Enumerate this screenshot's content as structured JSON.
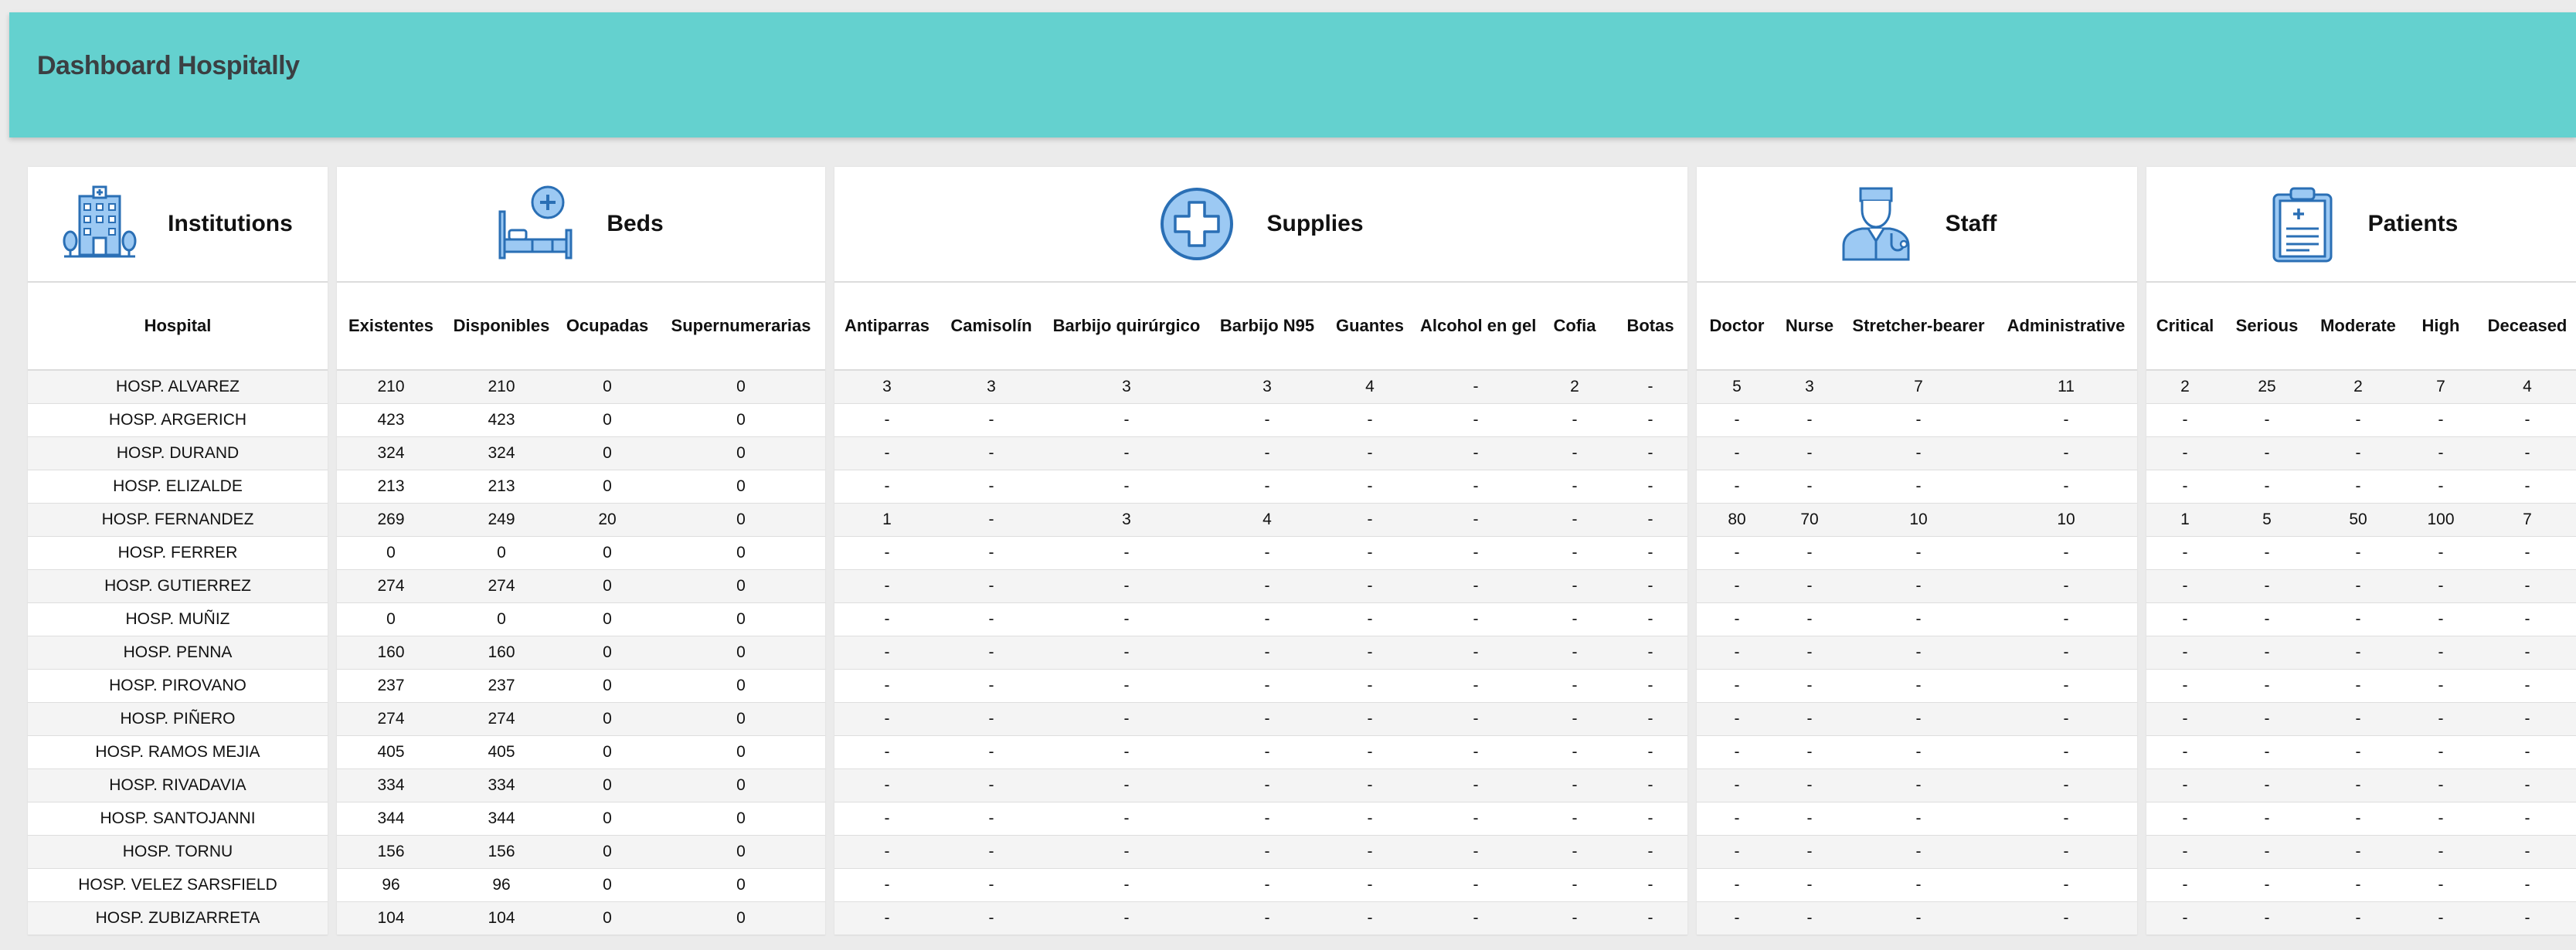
{
  "app": {
    "title": "Dashboard Hospitally"
  },
  "colors": {
    "header_bg": "#64d1cf",
    "icon_fill": "#9cc9f3",
    "icon_stroke": "#2a6fb5"
  },
  "panels": {
    "institutions": {
      "title": "Institutions",
      "icon": "hospital-building-icon",
      "columns": [
        "Hospital"
      ],
      "rows": [
        [
          "HOSP. ALVAREZ"
        ],
        [
          "HOSP. ARGERICH"
        ],
        [
          "HOSP. DURAND"
        ],
        [
          "HOSP. ELIZALDE"
        ],
        [
          "HOSP. FERNANDEZ"
        ],
        [
          "HOSP. FERRER"
        ],
        [
          "HOSP. GUTIERREZ"
        ],
        [
          "HOSP. MUÑIZ"
        ],
        [
          "HOSP. PENNA"
        ],
        [
          "HOSP. PIROVANO"
        ],
        [
          "HOSP. PIÑERO"
        ],
        [
          "HOSP. RAMOS MEJIA"
        ],
        [
          "HOSP. RIVADAVIA"
        ],
        [
          "HOSP. SANTOJANNI"
        ],
        [
          "HOSP. TORNU"
        ],
        [
          "HOSP. VELEZ SARSFIELD"
        ],
        [
          "HOSP. ZUBIZARRETA"
        ]
      ]
    },
    "beds": {
      "title": "Beds",
      "icon": "hospital-bed-icon",
      "columns": [
        "Existentes",
        "Disponibles",
        "Ocupadas",
        "Supernumerarias"
      ],
      "rows": [
        [
          "210",
          "210",
          "0",
          "0"
        ],
        [
          "423",
          "423",
          "0",
          "0"
        ],
        [
          "324",
          "324",
          "0",
          "0"
        ],
        [
          "213",
          "213",
          "0",
          "0"
        ],
        [
          "269",
          "249",
          "20",
          "0"
        ],
        [
          "0",
          "0",
          "0",
          "0"
        ],
        [
          "274",
          "274",
          "0",
          "0"
        ],
        [
          "0",
          "0",
          "0",
          "0"
        ],
        [
          "160",
          "160",
          "0",
          "0"
        ],
        [
          "237",
          "237",
          "0",
          "0"
        ],
        [
          "274",
          "274",
          "0",
          "0"
        ],
        [
          "405",
          "405",
          "0",
          "0"
        ],
        [
          "334",
          "334",
          "0",
          "0"
        ],
        [
          "344",
          "344",
          "0",
          "0"
        ],
        [
          "156",
          "156",
          "0",
          "0"
        ],
        [
          "96",
          "96",
          "0",
          "0"
        ],
        [
          "104",
          "104",
          "0",
          "0"
        ]
      ]
    },
    "supplies": {
      "title": "Supplies",
      "icon": "medical-cross-icon",
      "columns": [
        "Antiparras",
        "Camisolín",
        "Barbijo quirúrgico",
        "Barbijo N95",
        "Guantes",
        "Alcohol en gel",
        "Cofia",
        "Botas"
      ],
      "rows": [
        [
          "3",
          "3",
          "3",
          "3",
          "4",
          "-",
          "2",
          "-"
        ],
        [
          "-",
          "-",
          "-",
          "-",
          "-",
          "-",
          "-",
          "-"
        ],
        [
          "-",
          "-",
          "-",
          "-",
          "-",
          "-",
          "-",
          "-"
        ],
        [
          "-",
          "-",
          "-",
          "-",
          "-",
          "-",
          "-",
          "-"
        ],
        [
          "1",
          "-",
          "3",
          "4",
          "-",
          "-",
          "-",
          "-"
        ],
        [
          "-",
          "-",
          "-",
          "-",
          "-",
          "-",
          "-",
          "-"
        ],
        [
          "-",
          "-",
          "-",
          "-",
          "-",
          "-",
          "-",
          "-"
        ],
        [
          "-",
          "-",
          "-",
          "-",
          "-",
          "-",
          "-",
          "-"
        ],
        [
          "-",
          "-",
          "-",
          "-",
          "-",
          "-",
          "-",
          "-"
        ],
        [
          "-",
          "-",
          "-",
          "-",
          "-",
          "-",
          "-",
          "-"
        ],
        [
          "-",
          "-",
          "-",
          "-",
          "-",
          "-",
          "-",
          "-"
        ],
        [
          "-",
          "-",
          "-",
          "-",
          "-",
          "-",
          "-",
          "-"
        ],
        [
          "-",
          "-",
          "-",
          "-",
          "-",
          "-",
          "-",
          "-"
        ],
        [
          "-",
          "-",
          "-",
          "-",
          "-",
          "-",
          "-",
          "-"
        ],
        [
          "-",
          "-",
          "-",
          "-",
          "-",
          "-",
          "-",
          "-"
        ],
        [
          "-",
          "-",
          "-",
          "-",
          "-",
          "-",
          "-",
          "-"
        ],
        [
          "-",
          "-",
          "-",
          "-",
          "-",
          "-",
          "-",
          "-"
        ]
      ]
    },
    "staff": {
      "title": "Staff",
      "icon": "doctor-icon",
      "columns": [
        "Doctor",
        "Nurse",
        "Stretcher-bearer",
        "Administrative"
      ],
      "rows": [
        [
          "5",
          "3",
          "7",
          "11"
        ],
        [
          "-",
          "-",
          "-",
          "-"
        ],
        [
          "-",
          "-",
          "-",
          "-"
        ],
        [
          "-",
          "-",
          "-",
          "-"
        ],
        [
          "80",
          "70",
          "10",
          "10"
        ],
        [
          "-",
          "-",
          "-",
          "-"
        ],
        [
          "-",
          "-",
          "-",
          "-"
        ],
        [
          "-",
          "-",
          "-",
          "-"
        ],
        [
          "-",
          "-",
          "-",
          "-"
        ],
        [
          "-",
          "-",
          "-",
          "-"
        ],
        [
          "-",
          "-",
          "-",
          "-"
        ],
        [
          "-",
          "-",
          "-",
          "-"
        ],
        [
          "-",
          "-",
          "-",
          "-"
        ],
        [
          "-",
          "-",
          "-",
          "-"
        ],
        [
          "-",
          "-",
          "-",
          "-"
        ],
        [
          "-",
          "-",
          "-",
          "-"
        ],
        [
          "-",
          "-",
          "-",
          "-"
        ]
      ]
    },
    "patients": {
      "title": "Patients",
      "icon": "clipboard-icon",
      "columns": [
        "Critical",
        "Serious",
        "Moderate",
        "High",
        "Deceased"
      ],
      "rows": [
        [
          "2",
          "25",
          "2",
          "7",
          "4"
        ],
        [
          "-",
          "-",
          "-",
          "-",
          "-"
        ],
        [
          "-",
          "-",
          "-",
          "-",
          "-"
        ],
        [
          "-",
          "-",
          "-",
          "-",
          "-"
        ],
        [
          "1",
          "5",
          "50",
          "100",
          "7"
        ],
        [
          "-",
          "-",
          "-",
          "-",
          "-"
        ],
        [
          "-",
          "-",
          "-",
          "-",
          "-"
        ],
        [
          "-",
          "-",
          "-",
          "-",
          "-"
        ],
        [
          "-",
          "-",
          "-",
          "-",
          "-"
        ],
        [
          "-",
          "-",
          "-",
          "-",
          "-"
        ],
        [
          "-",
          "-",
          "-",
          "-",
          "-"
        ],
        [
          "-",
          "-",
          "-",
          "-",
          "-"
        ],
        [
          "-",
          "-",
          "-",
          "-",
          "-"
        ],
        [
          "-",
          "-",
          "-",
          "-",
          "-"
        ],
        [
          "-",
          "-",
          "-",
          "-",
          "-"
        ],
        [
          "-",
          "-",
          "-",
          "-",
          "-"
        ],
        [
          "-",
          "-",
          "-",
          "-",
          "-"
        ]
      ]
    }
  }
}
